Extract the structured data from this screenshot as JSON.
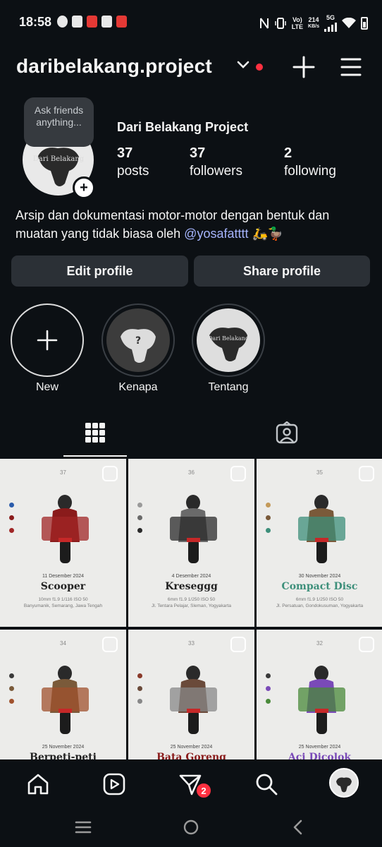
{
  "status_bar": {
    "time": "18:58",
    "lte_top": "Vo)",
    "lte_bottom": "LTE",
    "speed_top": "214",
    "speed_bottom": "KB/s",
    "network": "5G"
  },
  "header": {
    "username": "daribelakang.project",
    "icons": [
      "chevron-down-icon",
      "plus-icon",
      "menu-icon"
    ]
  },
  "profile": {
    "note": "Ask friends anything...",
    "avatar_text": "Dari Belakang",
    "display_name": "Dari Belakang Project",
    "stats": [
      {
        "num": "37",
        "label": "posts"
      },
      {
        "num": "37",
        "label": "followers"
      },
      {
        "num": "2",
        "label": "following"
      }
    ],
    "bio_text": "Arsip dan dokumentasi motor-motor dengan bentuk dan muatan yang tidak biasa oleh ",
    "bio_mention": "@yosafatttt",
    "bio_emoji": " 🛵🦆"
  },
  "buttons": {
    "edit": "Edit profile",
    "share": "Share profile"
  },
  "highlights": [
    {
      "label": "New"
    },
    {
      "label": "Kenapa",
      "cover_text": "?"
    },
    {
      "label": "Tentang",
      "cover_text": "Dari Belakang"
    }
  ],
  "posts": [
    {
      "n": "37",
      "date": "11 Desember 2024",
      "title": "Scooper",
      "spec": "10mm f1.9 1/116 ISO 50",
      "loc": "Banyumanik, Semarang, Jawa Tengah",
      "title_color": "#222222",
      "dots": [
        "#2b5cab",
        "#8a1b1b",
        "#a02626"
      ]
    },
    {
      "n": "36",
      "date": "4 Desember 2024",
      "title": "Kreseggg",
      "spec": "6mm f1.9 1/250 ISO 50",
      "loc": "Jl. Tentara Pelajar, Sleman, Yogyakarta",
      "title_color": "#222222",
      "dots": [
        "#9a9a9a",
        "#6a6a6a",
        "#2a2a2a"
      ]
    },
    {
      "n": "35",
      "date": "30 November 2024",
      "title": "Compact Disc",
      "spec": "6mm f1.9 1/250 ISO 50",
      "loc": "Jl. Persatuan, Gondokusuman, Yogyakarta",
      "title_color": "#3d8f7a",
      "dots": [
        "#c49a5a",
        "#7a5a3a",
        "#3d8f7a"
      ]
    },
    {
      "n": "34",
      "date": "25 November 2024",
      "title": "Berpeti-peti",
      "spec": "",
      "loc": "",
      "title_color": "#222222",
      "dots": [
        "#3a3a3a",
        "#7a5a3a",
        "#a0522d"
      ]
    },
    {
      "n": "33",
      "date": "25 November 2024",
      "title": "Bata Goreng",
      "spec": "",
      "loc": "",
      "title_color": "#8a1b1b",
      "dots": [
        "#8a3a2a",
        "#6a4a3a",
        "#888888"
      ]
    },
    {
      "n": "32",
      "date": "25 November 2024",
      "title": "Aci Dicolok",
      "spec": "",
      "loc": "",
      "title_color": "#7a4ab8",
      "dots": [
        "#3a3a3a",
        "#7a4ab8",
        "#4a8a3a"
      ]
    }
  ],
  "nav": {
    "messages_badge": "2",
    "icons": [
      "home-icon",
      "reels-icon",
      "direct-icon",
      "search-icon",
      "profile-icon"
    ]
  }
}
